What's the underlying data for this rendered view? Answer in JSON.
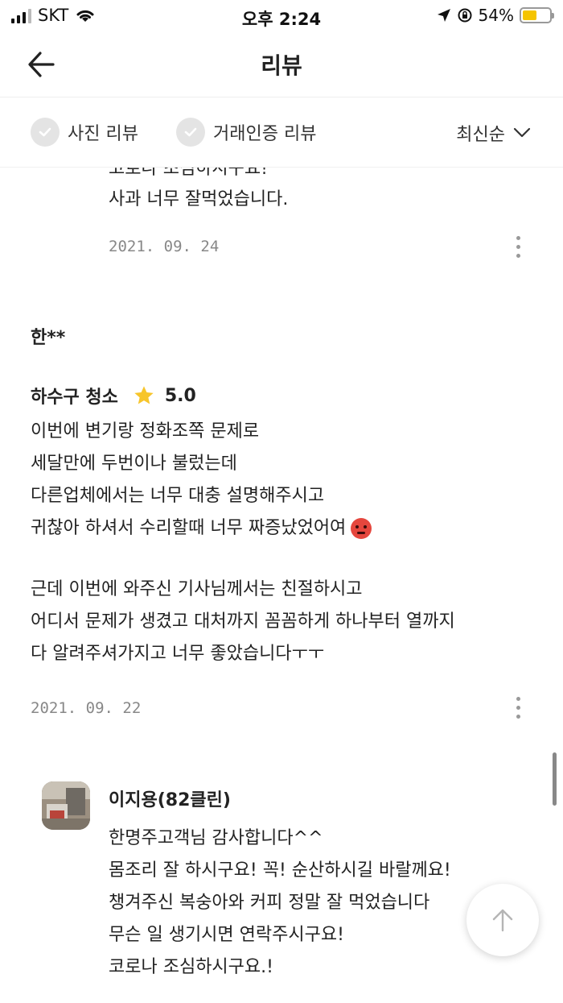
{
  "status_bar": {
    "carrier": "SKT",
    "time": "오후 2:24",
    "battery_percent": "54%",
    "battery_level": 0.54
  },
  "header": {
    "title": "리뷰"
  },
  "filters": {
    "photo_review": "사진 리뷰",
    "verified_review": "거래인증 리뷰",
    "sort": "최신순"
  },
  "previous_review": {
    "cut_line": "코로나 조심하시구요!",
    "last_line": "사과 너무 잘먹었습니다.",
    "date": "2021. 09. 24"
  },
  "review": {
    "author": "한**",
    "service": "하수구 청소",
    "rating": "5.0",
    "lines": [
      "이번에 변기랑 정화조쪽 문제로",
      "세달만에 두번이나 불렀는데",
      "다른업체에서는 너무 대충 설명해주시고",
      "귀찮아 하셔서 수리할때 너무 짜증났었어여",
      "근데 이번에 와주신 기사님께서는 친절하시고",
      "어디서 문제가 생겼고 대처까지 꼼꼼하게 하나부터 열까지",
      "다 알려주셔가지고 너무 좋았습니다ㅜㅜ"
    ],
    "date": "2021. 09. 22"
  },
  "reply": {
    "name": "이지용(82클린)",
    "lines": [
      "한명주고객님 감사합니다^^",
      "몸조리 잘 하시구요! 꼭! 순산하시길 바랄께요!",
      "챙겨주신 복숭아와 커피 정말 잘 먹었습니다",
      "무슨 일 생기시면 연락주시구요!",
      "코로나 조심하시구요.!"
    ]
  },
  "icons": {
    "back": "arrow-left-icon",
    "check": "check-icon",
    "sort": "chevron-down-icon",
    "more": "more-vertical-icon",
    "star": "star-icon",
    "emoji": "angry-face-icon",
    "top": "arrow-up-icon"
  },
  "colors": {
    "star": "#f7c52b",
    "battery": "#f5c400",
    "check_bg": "#e4e4e4",
    "date": "#888888"
  }
}
